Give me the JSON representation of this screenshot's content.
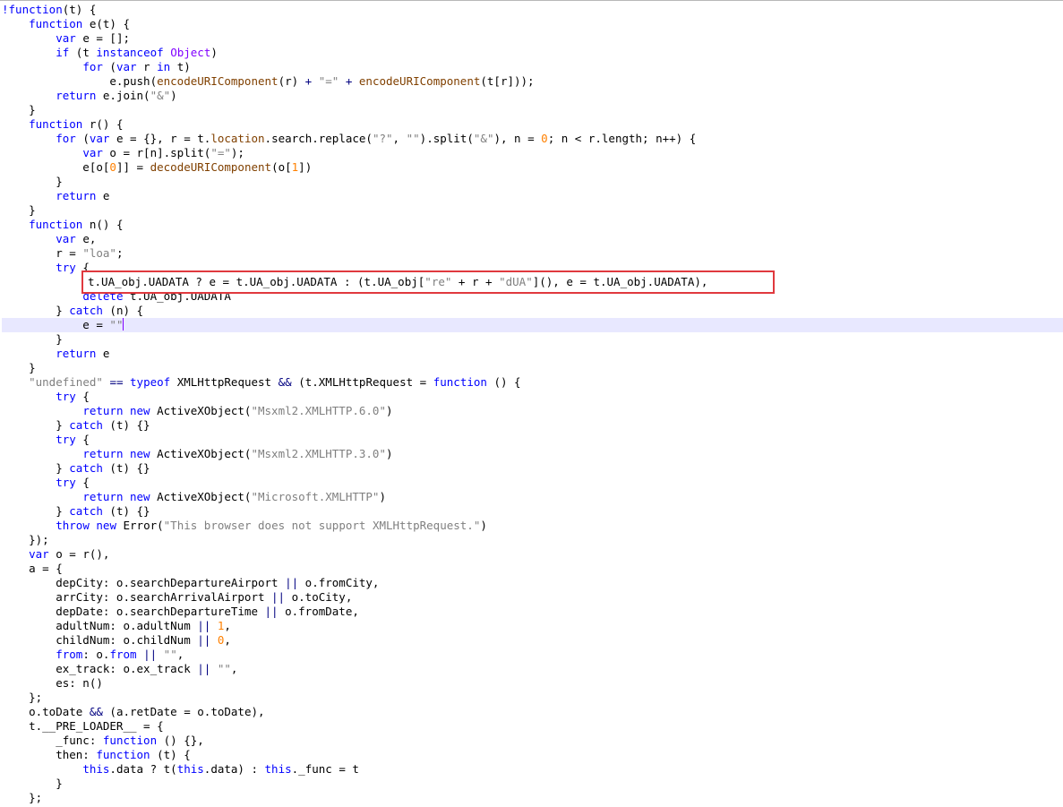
{
  "editor": {
    "colors": {
      "keyword": "#0000ff",
      "string": "#808080",
      "number": "#ff8000",
      "builtin_object": "#8000ff",
      "function_name": "#804000",
      "operator": "#000080",
      "current_line": "#e8e8ff",
      "highlight_box": "#e0393e"
    },
    "current_line_index": 22,
    "highlighted_line_index": 19,
    "lines": [
      [
        [
          "kw",
          "!function"
        ],
        [
          "",
          "(t) {"
        ]
      ],
      [
        [
          "",
          "    "
        ],
        [
          "kw",
          "function"
        ],
        [
          "",
          " e(t) {"
        ]
      ],
      [
        [
          "",
          "        "
        ],
        [
          "kw",
          "var"
        ],
        [
          "",
          " e = [];"
        ]
      ],
      [
        [
          "",
          "        "
        ],
        [
          "kw",
          "if"
        ],
        [
          "",
          " (t "
        ],
        [
          "kw",
          "instanceof"
        ],
        [
          "",
          " "
        ],
        [
          "obj",
          "Object"
        ],
        [
          "",
          ")"
        ]
      ],
      [
        [
          "",
          "            "
        ],
        [
          "kw",
          "for"
        ],
        [
          "",
          " ("
        ],
        [
          "kw",
          "var"
        ],
        [
          "",
          " r "
        ],
        [
          "kw",
          "in"
        ],
        [
          "",
          " t)"
        ]
      ],
      [
        [
          "",
          "                e.push("
        ],
        [
          "fn",
          "encodeURIComponent"
        ],
        [
          "",
          "(r) "
        ],
        [
          "op",
          "+"
        ],
        [
          "",
          " "
        ],
        [
          "str",
          "\"=\""
        ],
        [
          "",
          " "
        ],
        [
          "op",
          "+"
        ],
        [
          "",
          " "
        ],
        [
          "fn",
          "encodeURIComponent"
        ],
        [
          "",
          "(t[r]));"
        ]
      ],
      [
        [
          "",
          "        "
        ],
        [
          "kw",
          "return"
        ],
        [
          "",
          " e.join("
        ],
        [
          "str",
          "\"&\""
        ],
        [
          "",
          ")"
        ]
      ],
      [
        [
          "",
          "    }"
        ]
      ],
      [
        [
          "",
          "    "
        ],
        [
          "kw",
          "function"
        ],
        [
          "",
          " r() {"
        ]
      ],
      [
        [
          "",
          "        "
        ],
        [
          "kw",
          "for"
        ],
        [
          "",
          " ("
        ],
        [
          "kw",
          "var"
        ],
        [
          "",
          " e = {}, r = t."
        ],
        [
          "fn",
          "location"
        ],
        [
          "",
          ".search.replace("
        ],
        [
          "str",
          "\"?\""
        ],
        [
          "",
          ", "
        ],
        [
          "str",
          "\"\""
        ],
        [
          "",
          ").split("
        ],
        [
          "str",
          "\"&\""
        ],
        [
          "",
          "), n = "
        ],
        [
          "num",
          "0"
        ],
        [
          "",
          "; n < r.length; n++) {"
        ]
      ],
      [
        [
          "",
          "            "
        ],
        [
          "kw",
          "var"
        ],
        [
          "",
          " o = r[n].split("
        ],
        [
          "str",
          "\"=\""
        ],
        [
          "",
          ");"
        ]
      ],
      [
        [
          "",
          "            e[o["
        ],
        [
          "num",
          "0"
        ],
        [
          "",
          "]] = "
        ],
        [
          "fn",
          "decodeURIComponent"
        ],
        [
          "",
          "(o["
        ],
        [
          "num",
          "1"
        ],
        [
          "",
          "])"
        ]
      ],
      [
        [
          "",
          "        }"
        ]
      ],
      [
        [
          "",
          "        "
        ],
        [
          "kw",
          "return"
        ],
        [
          "",
          " e"
        ]
      ],
      [
        [
          "",
          "    }"
        ]
      ],
      [
        [
          "",
          "    "
        ],
        [
          "kw",
          "function"
        ],
        [
          "",
          " n() {"
        ]
      ],
      [
        [
          "",
          "        "
        ],
        [
          "kw",
          "var"
        ],
        [
          "",
          " e,"
        ]
      ],
      [
        [
          "",
          "        r = "
        ],
        [
          "str",
          "\"loa\""
        ],
        [
          "",
          ";"
        ]
      ],
      [
        [
          "",
          "        "
        ],
        [
          "kw",
          "try"
        ],
        [
          "",
          " {"
        ]
      ],
      [
        [
          "",
          "            "
        ],
        [
          "",
          "t.UA_obj.UADATA ? e = t.UA_obj.UADATA : (t.UA_obj["
        ],
        [
          "str",
          "\"re\""
        ],
        [
          "",
          " + r + "
        ],
        [
          "str",
          "\"dUA\""
        ],
        [
          "",
          "](), e = t.UA_obj.UADATA),"
        ]
      ],
      [
        [
          "",
          "            "
        ],
        [
          "kw",
          "delete"
        ],
        [
          "",
          " t.UA_obj.UADATA"
        ]
      ],
      [
        [
          "",
          "        } "
        ],
        [
          "kw",
          "catch"
        ],
        [
          "",
          " (n) {"
        ]
      ],
      [
        [
          "",
          "            e = "
        ],
        [
          "str",
          "\"\""
        ]
      ],
      [
        [
          "",
          "        }"
        ]
      ],
      [
        [
          "",
          "        "
        ],
        [
          "kw",
          "return"
        ],
        [
          "",
          " e"
        ]
      ],
      [
        [
          "",
          "    }"
        ]
      ],
      [
        [
          "",
          "    "
        ],
        [
          "str",
          "\"undefined\""
        ],
        [
          "",
          " "
        ],
        [
          "op",
          "=="
        ],
        [
          "",
          " "
        ],
        [
          "kw",
          "typeof"
        ],
        [
          "",
          " XMLHttpRequest "
        ],
        [
          "op",
          "&&"
        ],
        [
          "",
          " (t.XMLHttpRequest = "
        ],
        [
          "kw",
          "function"
        ],
        [
          "",
          " () {"
        ]
      ],
      [
        [
          "",
          "        "
        ],
        [
          "kw",
          "try"
        ],
        [
          "",
          " {"
        ]
      ],
      [
        [
          "",
          "            "
        ],
        [
          "kw",
          "return"
        ],
        [
          "",
          " "
        ],
        [
          "kw",
          "new"
        ],
        [
          "",
          " ActiveXObject("
        ],
        [
          "str",
          "\"Msxml2.XMLHTTP.6.0\""
        ],
        [
          "",
          ")"
        ]
      ],
      [
        [
          "",
          "        } "
        ],
        [
          "kw",
          "catch"
        ],
        [
          "",
          " (t) {}"
        ]
      ],
      [
        [
          "",
          "        "
        ],
        [
          "kw",
          "try"
        ],
        [
          "",
          " {"
        ]
      ],
      [
        [
          "",
          "            "
        ],
        [
          "kw",
          "return"
        ],
        [
          "",
          " "
        ],
        [
          "kw",
          "new"
        ],
        [
          "",
          " ActiveXObject("
        ],
        [
          "str",
          "\"Msxml2.XMLHTTP.3.0\""
        ],
        [
          "",
          ")"
        ]
      ],
      [
        [
          "",
          "        } "
        ],
        [
          "kw",
          "catch"
        ],
        [
          "",
          " (t) {}"
        ]
      ],
      [
        [
          "",
          "        "
        ],
        [
          "kw",
          "try"
        ],
        [
          "",
          " {"
        ]
      ],
      [
        [
          "",
          "            "
        ],
        [
          "kw",
          "return"
        ],
        [
          "",
          " "
        ],
        [
          "kw",
          "new"
        ],
        [
          "",
          " ActiveXObject("
        ],
        [
          "str",
          "\"Microsoft.XMLHTTP\""
        ],
        [
          "",
          ")"
        ]
      ],
      [
        [
          "",
          "        } "
        ],
        [
          "kw",
          "catch"
        ],
        [
          "",
          " (t) {}"
        ]
      ],
      [
        [
          "",
          "        "
        ],
        [
          "kw",
          "throw"
        ],
        [
          "",
          " "
        ],
        [
          "kw",
          "new"
        ],
        [
          "",
          " Error("
        ],
        [
          "str",
          "\"This browser does not support XMLHttpRequest.\""
        ],
        [
          "",
          ")"
        ]
      ],
      [
        [
          "",
          "    });"
        ]
      ],
      [
        [
          "",
          "    "
        ],
        [
          "kw",
          "var"
        ],
        [
          "",
          " o = r(),"
        ]
      ],
      [
        [
          "",
          "    a = {"
        ]
      ],
      [
        [
          "",
          "        depCity: o.searchDepartureAirport "
        ],
        [
          "op",
          "||"
        ],
        [
          "",
          " o.fromCity,"
        ]
      ],
      [
        [
          "",
          "        arrCity: o.searchArrivalAirport "
        ],
        [
          "op",
          "||"
        ],
        [
          "",
          " o.toCity,"
        ]
      ],
      [
        [
          "",
          "        depDate: o.searchDepartureTime "
        ],
        [
          "op",
          "||"
        ],
        [
          "",
          " o.fromDate,"
        ]
      ],
      [
        [
          "",
          "        adultNum: o.adultNum "
        ],
        [
          "op",
          "||"
        ],
        [
          "",
          " "
        ],
        [
          "num",
          "1"
        ],
        [
          "",
          ","
        ]
      ],
      [
        [
          "",
          "        childNum: o.childNum "
        ],
        [
          "op",
          "||"
        ],
        [
          "",
          " "
        ],
        [
          "num",
          "0"
        ],
        [
          "",
          ","
        ]
      ],
      [
        [
          "",
          "        "
        ],
        [
          "kw",
          "from"
        ],
        [
          "",
          ": o."
        ],
        [
          "kw",
          "from"
        ],
        [
          "",
          " "
        ],
        [
          "op",
          "||"
        ],
        [
          "",
          " "
        ],
        [
          "str",
          "\"\""
        ],
        [
          "",
          ","
        ]
      ],
      [
        [
          "",
          "        ex_track: o.ex_track "
        ],
        [
          "op",
          "||"
        ],
        [
          "",
          " "
        ],
        [
          "str",
          "\"\""
        ],
        [
          "",
          ","
        ]
      ],
      [
        [
          "",
          "        es: n()"
        ]
      ],
      [
        [
          "",
          "    };"
        ]
      ],
      [
        [
          "",
          "    o.toDate "
        ],
        [
          "op",
          "&&"
        ],
        [
          "",
          " (a.retDate = o.toDate),"
        ]
      ],
      [
        [
          "",
          "    t.__PRE_LOADER__ = {"
        ]
      ],
      [
        [
          "",
          "        _func: "
        ],
        [
          "kw",
          "function"
        ],
        [
          "",
          " () {},"
        ]
      ],
      [
        [
          "",
          "        then: "
        ],
        [
          "kw",
          "function"
        ],
        [
          "",
          " (t) {"
        ]
      ],
      [
        [
          "",
          "            "
        ],
        [
          "kw",
          "this"
        ],
        [
          "",
          ".data ? t("
        ],
        [
          "kw",
          "this"
        ],
        [
          "",
          ".data) : "
        ],
        [
          "kw",
          "this"
        ],
        [
          "",
          "._func = t"
        ]
      ],
      [
        [
          "",
          "        }"
        ]
      ],
      [
        [
          "",
          "    };"
        ]
      ]
    ]
  }
}
